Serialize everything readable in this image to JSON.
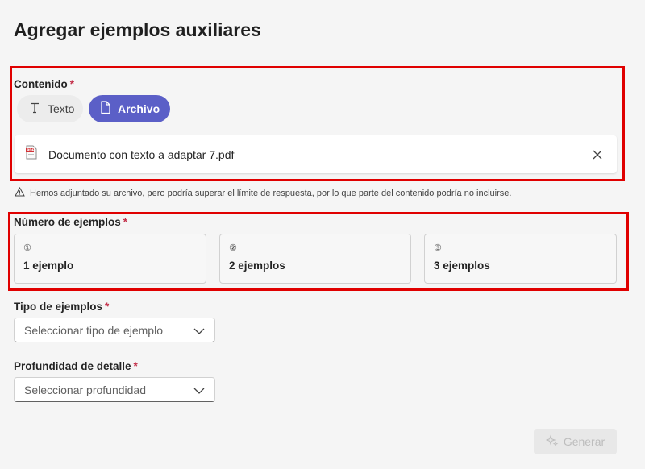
{
  "page": {
    "title": "Agregar ejemplos auxiliares"
  },
  "content": {
    "label": "Contenido",
    "required_mark": "*",
    "tabs": [
      {
        "label": "Texto",
        "icon": "text-icon",
        "selected": false
      },
      {
        "label": "Archivo",
        "icon": "file-icon",
        "selected": true
      }
    ],
    "file": {
      "name": "Documento con texto a adaptar 7.pdf",
      "icon": "pdf-icon"
    },
    "warning": "Hemos adjuntado su archivo, pero podría superar el límite de respuesta, por lo que parte del contenido podría no incluirse."
  },
  "examples_count": {
    "label": "Número de ejemplos",
    "required_mark": "*",
    "options": [
      {
        "number": "①",
        "label": "1 ejemplo"
      },
      {
        "number": "②",
        "label": "2 ejemplos"
      },
      {
        "number": "③",
        "label": "3 ejemplos"
      }
    ]
  },
  "example_type": {
    "label": "Tipo de ejemplos",
    "required_mark": "*",
    "placeholder": "Seleccionar tipo de ejemplo"
  },
  "detail_depth": {
    "label": "Profundidad de detalle",
    "required_mark": "*",
    "placeholder": "Seleccionar profundidad"
  },
  "actions": {
    "generate_label": "Generar"
  },
  "colors": {
    "accent": "#5b5fc7",
    "required": "#c4314b",
    "highlight": "#e00000",
    "background": "#f5f5f5"
  }
}
